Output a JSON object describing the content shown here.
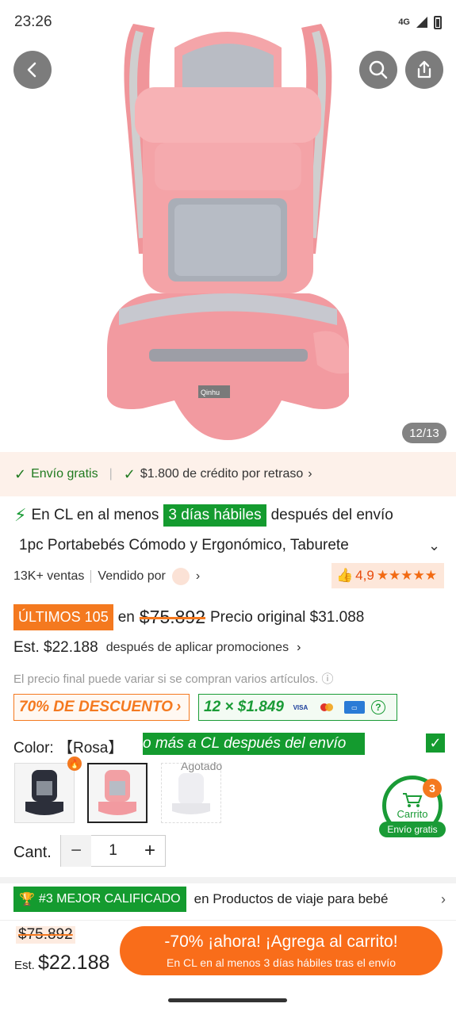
{
  "status_bar": {
    "time": "23:26",
    "network": "4G"
  },
  "hero": {
    "image_counter": "12/13",
    "logo": "Qinhu"
  },
  "icons": {
    "back": "back-arrow-icon",
    "search": "search-icon",
    "share": "share-icon"
  },
  "promo_strip": {
    "free_shipping": "Envío gratis",
    "credit": "$1.800 de crédito por retraso",
    "credit_chevron": "›"
  },
  "delivery": {
    "prefix": "En CL en al menos",
    "days": "3 días hábiles",
    "suffix": "después del envío"
  },
  "product": {
    "title": "1pc Portabebés Cómodo y Ergonómico, Taburete",
    "sales": "13K+ ventas",
    "sold_by": "Vendido por",
    "rating": "4,9",
    "stars": "★★★★★"
  },
  "pricing": {
    "last_badge": "ÚLTIMOS 105",
    "in_word": "en",
    "old_price": "$75.892",
    "original_label": "Precio original $31.088",
    "est_price": "Est. $22.188",
    "after_promos": "después de aplicar promociones",
    "disclaimer": "El precio final puede variar si se compran varios artículos."
  },
  "offers": {
    "discount": "70% DE DESCUENTO",
    "installments": "12 × $1.849",
    "visa": "VISA"
  },
  "variant": {
    "color_label": "Color:",
    "color_value": "【Rosa】",
    "marquee": "o más a CL después del envío",
    "sold_out": "Agotado"
  },
  "cart": {
    "count": "3",
    "label": "Carrito",
    "shipping": "Envío gratis"
  },
  "quantity": {
    "label": "Cant.",
    "value": "1",
    "minus": "−",
    "plus": "+"
  },
  "ranking": {
    "badge": "#3 MEJOR CALIFICADO",
    "category": "en Productos de viaje para bebé"
  },
  "bottom": {
    "old_price": "$75.892",
    "est_label": "Est. ",
    "est_value": "22.188",
    "est_currency": "$",
    "cta_main": "-70% ¡ahora! ¡Agrega al carrito!",
    "cta_sub": "En CL en al menos 3 días hábiles tras el envío"
  },
  "colors": {
    "accent_orange": "#f4791f",
    "accent_green": "#149b2f",
    "product_pink": "#f2a0a4"
  }
}
